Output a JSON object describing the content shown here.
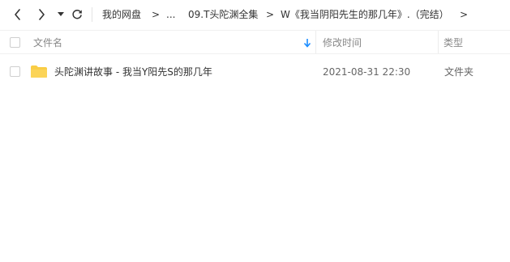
{
  "toolbar": {
    "back_icon": "chevron-left-icon",
    "forward_icon": "chevron-right-icon",
    "dropdown_icon": "caret-down-icon",
    "refresh_icon": "refresh-icon"
  },
  "breadcrumb": {
    "items": [
      {
        "label": "我的网盘"
      },
      {
        "label": "..."
      },
      {
        "label": "09.T头陀渊全集"
      },
      {
        "label": "W《我当阴阳先生的那几年》.（完结）"
      }
    ],
    "separator": ">"
  },
  "table": {
    "columns": {
      "name": "文件名",
      "modified": "修改时间",
      "type": "类型"
    },
    "sort_icon": "sort-down-arrow-icon",
    "accent_color": "#1a8cff",
    "rows": [
      {
        "icon": "folder-icon",
        "icon_color": "#f9cd45",
        "name": "头陀渊讲故事 - 我当Y阳先S的那几年",
        "modified": "2021-08-31 22:30",
        "type": "文件夹"
      }
    ]
  }
}
